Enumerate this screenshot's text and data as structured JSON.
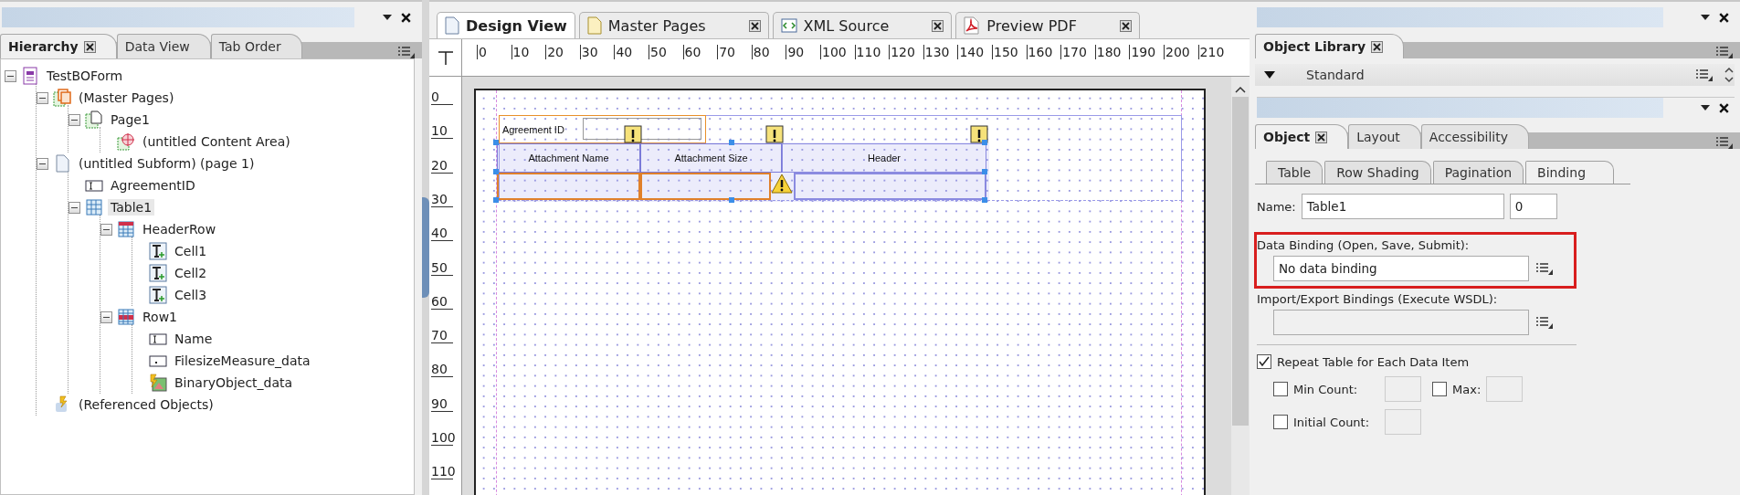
{
  "hierarchy_panel": {
    "tabs": [
      {
        "label": "Hierarchy",
        "selected": true,
        "closable": true
      },
      {
        "label": "Data View",
        "selected": false,
        "closable": false
      },
      {
        "label": "Tab Order",
        "selected": false,
        "closable": false
      }
    ],
    "tree": [
      {
        "label": "TestBOForm",
        "kind": "form",
        "expanded": true,
        "children": [
          {
            "label": "(Master Pages)",
            "kind": "master-pages",
            "expanded": true,
            "children": [
              {
                "label": "Page1",
                "kind": "page",
                "expanded": true,
                "children": [
                  {
                    "label": "(untitled Content Area)",
                    "kind": "content-area"
                  }
                ]
              }
            ]
          },
          {
            "label": "(untitled Subform) (page 1)",
            "kind": "subform",
            "expanded": true,
            "children": [
              {
                "label": "AgreementID",
                "kind": "text-field"
              },
              {
                "label": "Table1",
                "kind": "table",
                "expanded": true,
                "selected": true,
                "children": [
                  {
                    "label": "HeaderRow",
                    "kind": "header-row",
                    "expanded": true,
                    "selected": false,
                    "children": [
                      {
                        "label": "Cell1",
                        "kind": "text"
                      },
                      {
                        "label": "Cell2",
                        "kind": "text"
                      },
                      {
                        "label": "Cell3",
                        "kind": "text"
                      }
                    ]
                  },
                  {
                    "label": "Row1",
                    "kind": "row",
                    "expanded": true,
                    "selected": false,
                    "children": [
                      {
                        "label": "Name",
                        "kind": "text-field"
                      },
                      {
                        "label": "FilesizeMeasure_data",
                        "kind": "numeric-field"
                      },
                      {
                        "label": "BinaryObject_data",
                        "kind": "image-field"
                      }
                    ]
                  }
                ]
              }
            ]
          },
          {
            "label": "(Referenced Objects)",
            "kind": "referenced"
          }
        ]
      }
    ]
  },
  "editor": {
    "tabs": [
      {
        "label": "Design View",
        "kind": "design",
        "selected": true,
        "closable": false
      },
      {
        "label": "Master Pages",
        "kind": "master",
        "selected": false,
        "closable": true
      },
      {
        "label": "XML Source",
        "kind": "xml",
        "selected": false,
        "closable": true
      },
      {
        "label": "Preview PDF",
        "kind": "pdf",
        "selected": false,
        "closable": true
      }
    ],
    "ruler_horizontal": [
      "0",
      "10",
      "20",
      "30",
      "40",
      "50",
      "60",
      "70",
      "80",
      "90",
      "100",
      "110",
      "120",
      "130",
      "140",
      "150",
      "160",
      "170",
      "180",
      "190",
      "200",
      "210"
    ],
    "ruler_vertical": [
      "0",
      "10",
      "20",
      "30",
      "40",
      "50",
      "60",
      "70",
      "80",
      "90",
      "100",
      "110"
    ],
    "canvas": {
      "field_caption": "Agreement ID",
      "columns": [
        "Attachment Name",
        "Attachment Size",
        "Header"
      ]
    }
  },
  "object_library": {
    "tab": {
      "label": "Object Library",
      "closable": true
    },
    "category": {
      "label": "Standard",
      "expanded": true
    }
  },
  "object_panel": {
    "tabs": [
      {
        "label": "Object",
        "selected": true,
        "closable": true
      },
      {
        "label": "Layout",
        "selected": false,
        "closable": false
      },
      {
        "label": "Accessibility",
        "selected": false,
        "closable": false
      }
    ],
    "subtabs": [
      {
        "label": "Table",
        "selected": false
      },
      {
        "label": "Row Shading",
        "selected": false
      },
      {
        "label": "Pagination",
        "selected": false
      },
      {
        "label": "Binding",
        "selected": true
      }
    ],
    "name": {
      "label": "Name:",
      "value": "Table1",
      "index": "0"
    },
    "data_binding": {
      "label": "Data Binding (Open, Save, Submit):",
      "value": "No data binding",
      "highlighted": true
    },
    "import_export": {
      "label": "Import/Export Bindings (Execute WSDL):",
      "disabled": true
    },
    "repeat": {
      "label": "Repeat Table for Each Data Item",
      "checked": true
    },
    "min_count": {
      "label": "Min Count:",
      "checked": false,
      "disabled": true
    },
    "max": {
      "label": "Max:",
      "checked": false,
      "disabled": true
    },
    "initial_count": {
      "label": "Initial Count:",
      "checked": false,
      "disabled": true
    }
  }
}
